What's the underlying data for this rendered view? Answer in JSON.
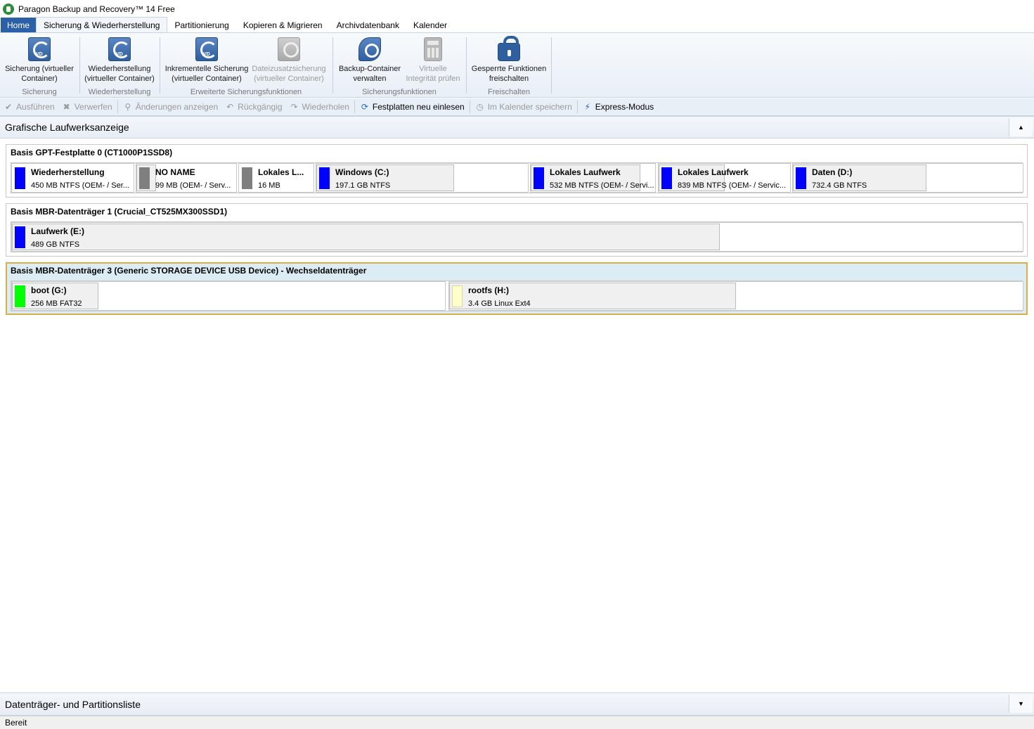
{
  "window": {
    "title": "Paragon Backup and Recovery™ 14 Free"
  },
  "tabs": [
    {
      "label": "Home"
    },
    {
      "label": "Sicherung & Wiederherstellung"
    },
    {
      "label": "Partitionierung"
    },
    {
      "label": "Kopieren & Migrieren"
    },
    {
      "label": "Archivdatenbank"
    },
    {
      "label": "Kalender"
    }
  ],
  "ribbon": {
    "groups": [
      {
        "label": "Sicherung",
        "buttons": [
          {
            "line1": "Sicherung (virtueller",
            "line2": "Container)",
            "icon": "backup-disk-icon",
            "enabled": true
          }
        ]
      },
      {
        "label": "Wiederherstellung",
        "buttons": [
          {
            "line1": "Wiederherstellung",
            "line2": "(virtueller Container)",
            "icon": "restore-disk-icon",
            "enabled": true
          }
        ]
      },
      {
        "label": "Erweiterte Sicherungsfunktionen",
        "buttons": [
          {
            "line1": "Inkrementelle Sicherung",
            "line2": "(virtueller Container)",
            "icon": "incremental-backup-icon",
            "enabled": true
          },
          {
            "line1": "Dateizusatzsicherung",
            "line2": "(virtueller Container)",
            "icon": "file-backup-icon",
            "enabled": false
          }
        ]
      },
      {
        "label": "Sicherungsfunktionen",
        "buttons": [
          {
            "line1": "Backup-Container",
            "line2": "verwalten",
            "icon": "container-manage-icon",
            "enabled": true
          },
          {
            "line1": "Virtuelle",
            "line2": "Integrität prüfen",
            "icon": "calculator-icon",
            "enabled": false
          }
        ]
      },
      {
        "label": "Freischalten",
        "buttons": [
          {
            "line1": "Gesperrte Funktionen",
            "line2": "freischalten",
            "icon": "lock-icon",
            "enabled": true
          }
        ]
      }
    ]
  },
  "toolbar": {
    "apply": "Ausführen",
    "discard": "Verwerfen",
    "show_changes": "Änderungen anzeigen",
    "undo": "Rückgängig",
    "redo": "Wiederholen",
    "rescan": "Festplatten neu einlesen",
    "schedule": "Im Kalender speichern",
    "express": "Express-Modus"
  },
  "graphic_view": {
    "title": "Grafische Laufwerksanzeige",
    "disks": [
      {
        "label": "Basis GPT-Festplatte 0 (CT1000P1SSD8)",
        "partitions": [
          {
            "name": "Wiederherstellung",
            "info": "450 MB NTFS (OEM- / Ser...",
            "color": "#0000ff",
            "used": 0.0
          },
          {
            "name": "NO NAME",
            "info": "99 MB  (OEM- / Serv...",
            "color": "#7f7f7f",
            "used": 0.2
          },
          {
            "name": "Lokales L...",
            "info": "16 MB",
            "color": "#7f7f7f",
            "used": 0.0
          },
          {
            "name": "Windows (C:)",
            "info": "197.1 GB NTFS",
            "color": "#0000ff",
            "used": 0.65
          },
          {
            "name": "Lokales Laufwerk",
            "info": "532 MB NTFS (OEM- / Servi...",
            "color": "#0000ff",
            "used": 0.88
          },
          {
            "name": "Lokales Laufwerk",
            "info": "839 MB NTFS (OEM- / Servic...",
            "color": "#0000ff",
            "used": 0.5
          },
          {
            "name": "Daten (D:)",
            "info": "732.4 GB NTFS",
            "color": "#0000ff",
            "used": 0.58
          }
        ]
      },
      {
        "label": "Basis MBR-Datenträger 1 (Crucial_CT525MX300SSD1)",
        "partitions": [
          {
            "name": "Laufwerk (E:)",
            "info": "489 GB NTFS",
            "color": "#0000ff",
            "used": 0.7
          }
        ]
      },
      {
        "label": "Basis MBR-Datenträger 3 (Generic STORAGE DEVICE USB Device) - Wechseldatenträger",
        "partitions": [
          {
            "name": "boot (G:)",
            "info": "256 MB FAT32",
            "color": "#00ff00",
            "used": 0.2
          },
          {
            "name": "rootfs (H:)",
            "info": "3.4 GB Linux Ext4",
            "color": "#ffffcc",
            "used": 0.5
          }
        ]
      }
    ]
  },
  "partition_list": {
    "title": "Datenträger- und Partitionsliste"
  },
  "status": {
    "text": "Bereit"
  }
}
